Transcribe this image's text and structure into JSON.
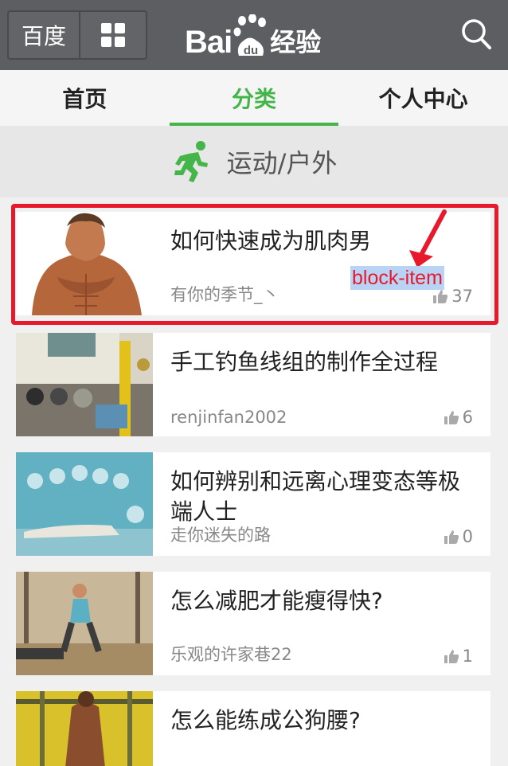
{
  "header": {
    "home_label": "百度",
    "logo_bai": "Bai",
    "logo_du": "du",
    "logo_jingyan": "经验",
    "icons": [
      "grid-icon",
      "baidu-paw-logo",
      "search-icon"
    ]
  },
  "tabs": [
    {
      "label": "首页",
      "active": false
    },
    {
      "label": "分类",
      "active": true
    },
    {
      "label": "个人中心",
      "active": false
    }
  ],
  "category": {
    "title": "运动/户外",
    "icon": "running-person-icon",
    "accent_color": "#44b549"
  },
  "annotation": {
    "label": "block-item",
    "color": "#e8192c"
  },
  "items": [
    {
      "title": "如何快速成为肌肉男",
      "author": "有你的季节_丶",
      "likes": "37",
      "thumb": "muscular-man"
    },
    {
      "title": "手工钓鱼线组的制作全过程",
      "author": "renjinfan2002",
      "likes": "6",
      "thumb": "fishing-line-kit"
    },
    {
      "title": "如何辨别和远离心理变态等极端人士",
      "author": "走你迷失的路",
      "likes": "0",
      "thumb": "balloons-person"
    },
    {
      "title": "怎么减肥才能瘦得快?",
      "author": "乐观的许家巷22",
      "likes": "1",
      "thumb": "gym-workout"
    },
    {
      "title": "怎么能练成公狗腰?",
      "author": "",
      "likes": "",
      "thumb": "gym-man"
    }
  ]
}
